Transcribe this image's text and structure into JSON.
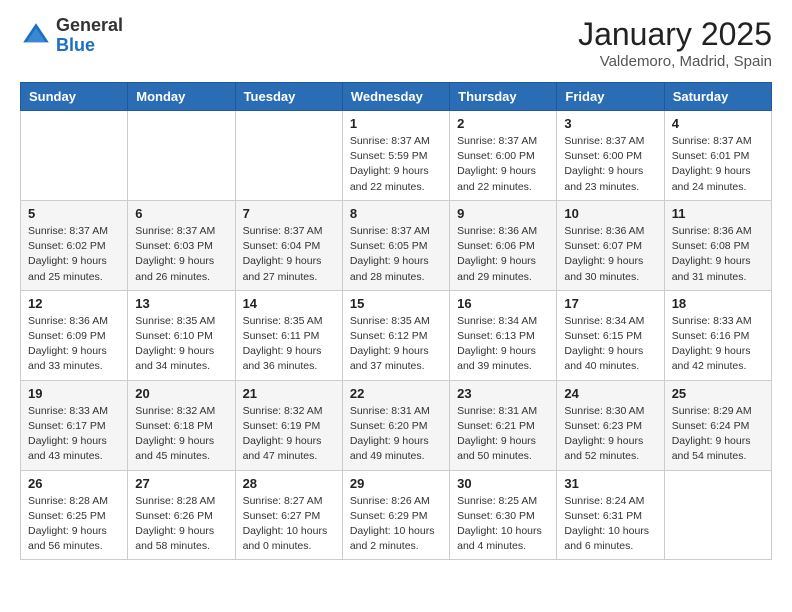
{
  "header": {
    "logo_general": "General",
    "logo_blue": "Blue",
    "title": "January 2025",
    "subtitle": "Valdemoro, Madrid, Spain"
  },
  "weekdays": [
    "Sunday",
    "Monday",
    "Tuesday",
    "Wednesday",
    "Thursday",
    "Friday",
    "Saturday"
  ],
  "weeks": [
    [
      {
        "day": "",
        "sunrise": "",
        "sunset": "",
        "daylight": ""
      },
      {
        "day": "",
        "sunrise": "",
        "sunset": "",
        "daylight": ""
      },
      {
        "day": "",
        "sunrise": "",
        "sunset": "",
        "daylight": ""
      },
      {
        "day": "1",
        "sunrise": "Sunrise: 8:37 AM",
        "sunset": "Sunset: 5:59 PM",
        "daylight": "Daylight: 9 hours and 22 minutes."
      },
      {
        "day": "2",
        "sunrise": "Sunrise: 8:37 AM",
        "sunset": "Sunset: 6:00 PM",
        "daylight": "Daylight: 9 hours and 22 minutes."
      },
      {
        "day": "3",
        "sunrise": "Sunrise: 8:37 AM",
        "sunset": "Sunset: 6:00 PM",
        "daylight": "Daylight: 9 hours and 23 minutes."
      },
      {
        "day": "4",
        "sunrise": "Sunrise: 8:37 AM",
        "sunset": "Sunset: 6:01 PM",
        "daylight": "Daylight: 9 hours and 24 minutes."
      }
    ],
    [
      {
        "day": "5",
        "sunrise": "Sunrise: 8:37 AM",
        "sunset": "Sunset: 6:02 PM",
        "daylight": "Daylight: 9 hours and 25 minutes."
      },
      {
        "day": "6",
        "sunrise": "Sunrise: 8:37 AM",
        "sunset": "Sunset: 6:03 PM",
        "daylight": "Daylight: 9 hours and 26 minutes."
      },
      {
        "day": "7",
        "sunrise": "Sunrise: 8:37 AM",
        "sunset": "Sunset: 6:04 PM",
        "daylight": "Daylight: 9 hours and 27 minutes."
      },
      {
        "day": "8",
        "sunrise": "Sunrise: 8:37 AM",
        "sunset": "Sunset: 6:05 PM",
        "daylight": "Daylight: 9 hours and 28 minutes."
      },
      {
        "day": "9",
        "sunrise": "Sunrise: 8:36 AM",
        "sunset": "Sunset: 6:06 PM",
        "daylight": "Daylight: 9 hours and 29 minutes."
      },
      {
        "day": "10",
        "sunrise": "Sunrise: 8:36 AM",
        "sunset": "Sunset: 6:07 PM",
        "daylight": "Daylight: 9 hours and 30 minutes."
      },
      {
        "day": "11",
        "sunrise": "Sunrise: 8:36 AM",
        "sunset": "Sunset: 6:08 PM",
        "daylight": "Daylight: 9 hours and 31 minutes."
      }
    ],
    [
      {
        "day": "12",
        "sunrise": "Sunrise: 8:36 AM",
        "sunset": "Sunset: 6:09 PM",
        "daylight": "Daylight: 9 hours and 33 minutes."
      },
      {
        "day": "13",
        "sunrise": "Sunrise: 8:35 AM",
        "sunset": "Sunset: 6:10 PM",
        "daylight": "Daylight: 9 hours and 34 minutes."
      },
      {
        "day": "14",
        "sunrise": "Sunrise: 8:35 AM",
        "sunset": "Sunset: 6:11 PM",
        "daylight": "Daylight: 9 hours and 36 minutes."
      },
      {
        "day": "15",
        "sunrise": "Sunrise: 8:35 AM",
        "sunset": "Sunset: 6:12 PM",
        "daylight": "Daylight: 9 hours and 37 minutes."
      },
      {
        "day": "16",
        "sunrise": "Sunrise: 8:34 AM",
        "sunset": "Sunset: 6:13 PM",
        "daylight": "Daylight: 9 hours and 39 minutes."
      },
      {
        "day": "17",
        "sunrise": "Sunrise: 8:34 AM",
        "sunset": "Sunset: 6:15 PM",
        "daylight": "Daylight: 9 hours and 40 minutes."
      },
      {
        "day": "18",
        "sunrise": "Sunrise: 8:33 AM",
        "sunset": "Sunset: 6:16 PM",
        "daylight": "Daylight: 9 hours and 42 minutes."
      }
    ],
    [
      {
        "day": "19",
        "sunrise": "Sunrise: 8:33 AM",
        "sunset": "Sunset: 6:17 PM",
        "daylight": "Daylight: 9 hours and 43 minutes."
      },
      {
        "day": "20",
        "sunrise": "Sunrise: 8:32 AM",
        "sunset": "Sunset: 6:18 PM",
        "daylight": "Daylight: 9 hours and 45 minutes."
      },
      {
        "day": "21",
        "sunrise": "Sunrise: 8:32 AM",
        "sunset": "Sunset: 6:19 PM",
        "daylight": "Daylight: 9 hours and 47 minutes."
      },
      {
        "day": "22",
        "sunrise": "Sunrise: 8:31 AM",
        "sunset": "Sunset: 6:20 PM",
        "daylight": "Daylight: 9 hours and 49 minutes."
      },
      {
        "day": "23",
        "sunrise": "Sunrise: 8:31 AM",
        "sunset": "Sunset: 6:21 PM",
        "daylight": "Daylight: 9 hours and 50 minutes."
      },
      {
        "day": "24",
        "sunrise": "Sunrise: 8:30 AM",
        "sunset": "Sunset: 6:23 PM",
        "daylight": "Daylight: 9 hours and 52 minutes."
      },
      {
        "day": "25",
        "sunrise": "Sunrise: 8:29 AM",
        "sunset": "Sunset: 6:24 PM",
        "daylight": "Daylight: 9 hours and 54 minutes."
      }
    ],
    [
      {
        "day": "26",
        "sunrise": "Sunrise: 8:28 AM",
        "sunset": "Sunset: 6:25 PM",
        "daylight": "Daylight: 9 hours and 56 minutes."
      },
      {
        "day": "27",
        "sunrise": "Sunrise: 8:28 AM",
        "sunset": "Sunset: 6:26 PM",
        "daylight": "Daylight: 9 hours and 58 minutes."
      },
      {
        "day": "28",
        "sunrise": "Sunrise: 8:27 AM",
        "sunset": "Sunset: 6:27 PM",
        "daylight": "Daylight: 10 hours and 0 minutes."
      },
      {
        "day": "29",
        "sunrise": "Sunrise: 8:26 AM",
        "sunset": "Sunset: 6:29 PM",
        "daylight": "Daylight: 10 hours and 2 minutes."
      },
      {
        "day": "30",
        "sunrise": "Sunrise: 8:25 AM",
        "sunset": "Sunset: 6:30 PM",
        "daylight": "Daylight: 10 hours and 4 minutes."
      },
      {
        "day": "31",
        "sunrise": "Sunrise: 8:24 AM",
        "sunset": "Sunset: 6:31 PM",
        "daylight": "Daylight: 10 hours and 6 minutes."
      },
      {
        "day": "",
        "sunrise": "",
        "sunset": "",
        "daylight": ""
      }
    ]
  ]
}
